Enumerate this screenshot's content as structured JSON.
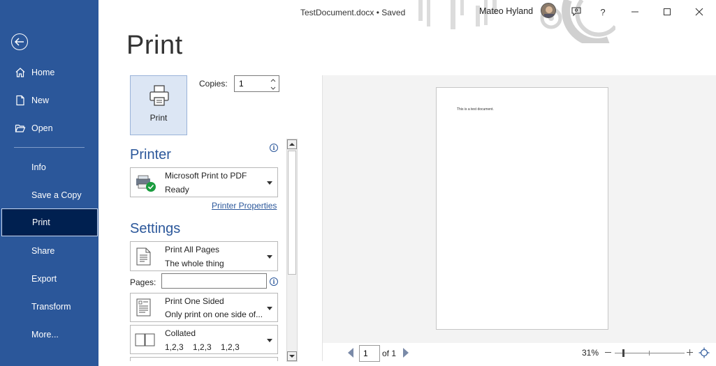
{
  "titlebar": {
    "doc_title": "TestDocument.docx  •  Saved",
    "user_name": "Mateo Hyland",
    "icons": [
      "feedback-icon",
      "help-icon",
      "minimize-icon",
      "restore-icon",
      "close-icon"
    ],
    "help_glyph": "?"
  },
  "sidebar": {
    "back_icon": "back-arrow-icon",
    "items": [
      {
        "label": "Home",
        "icon": "home-icon"
      },
      {
        "label": "New",
        "icon": "new-document-icon"
      },
      {
        "label": "Open",
        "icon": "folder-icon"
      },
      {
        "label": "Info"
      },
      {
        "label": "Save a Copy"
      },
      {
        "label": "Print",
        "active": true
      },
      {
        "label": "Share"
      },
      {
        "label": "Export"
      },
      {
        "label": "Transform"
      },
      {
        "label": "More..."
      }
    ],
    "colors": {
      "background": "#2b579a",
      "active": "#002050"
    }
  },
  "main": {
    "heading": "Print",
    "print_button": "Print",
    "copies_label": "Copies:",
    "copies_value": "1",
    "printer": {
      "heading": "Printer",
      "name": "Microsoft Print to PDF",
      "status": "Ready",
      "properties_link": "Printer Properties"
    },
    "settings": {
      "heading": "Settings",
      "pages_scope": {
        "title": "Print All Pages",
        "subtitle": "The whole thing"
      },
      "pages_label": "Pages:",
      "pages_value": "",
      "sides": {
        "title": "Print One Sided",
        "subtitle": "Only print on one side of..."
      },
      "collation": {
        "title": "Collated",
        "subtitle": "1,2,3    1,2,3    1,2,3"
      }
    }
  },
  "preview": {
    "page_text": "This is a test document.",
    "current_page": "1",
    "page_of": "of 1",
    "zoom": "31%",
    "zoom_level_fraction": 0.12
  },
  "info_glyph": "i",
  "accent_color": "#2b579a"
}
